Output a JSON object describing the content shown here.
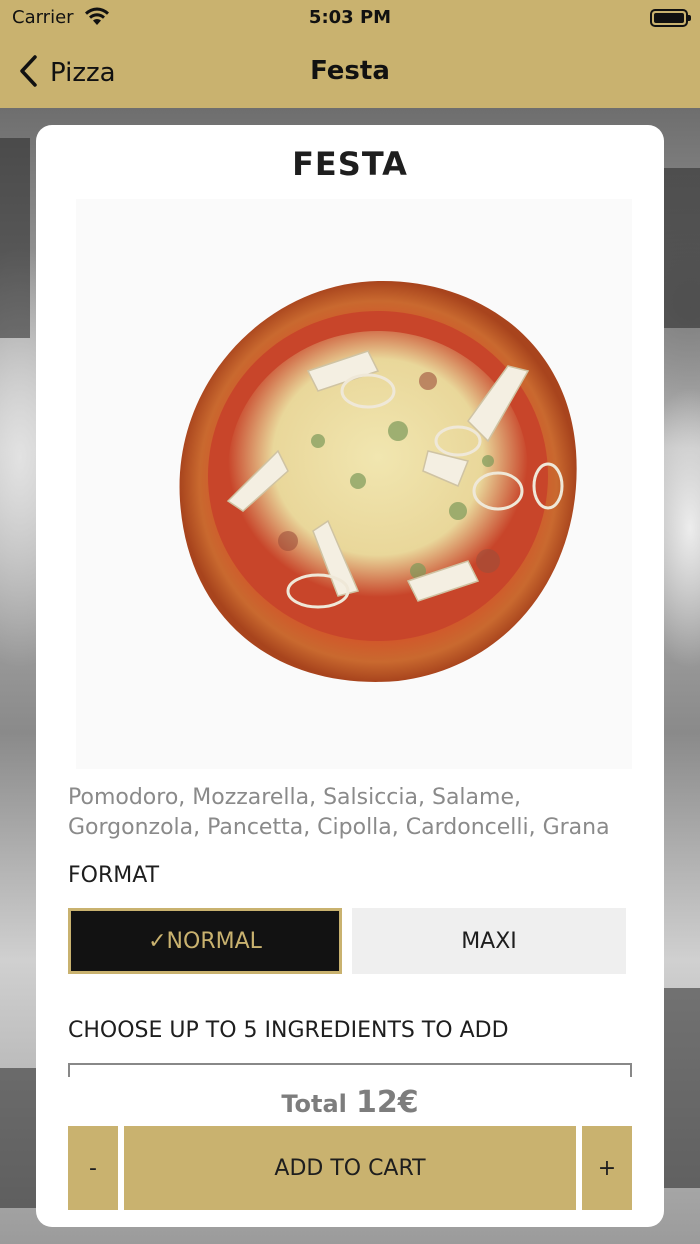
{
  "status_bar": {
    "carrier": "Carrier",
    "time": "5:03 PM"
  },
  "nav": {
    "back_label": "Pizza",
    "title": "Festa"
  },
  "product": {
    "name": "FESTA",
    "ingredients": "Pomodoro, Mozzarella, Salsiccia, Salame, Gorgonzola, Pancetta, Cipolla, Cardoncelli, Grana",
    "format_label": "FORMAT",
    "format_options": [
      {
        "label": "✓NORMAL",
        "selected": true
      },
      {
        "label": "MAXI",
        "selected": false
      }
    ],
    "choose_label": "CHOOSE UP TO 5 INGREDIENTS TO ADD"
  },
  "total": {
    "label": "Total",
    "value": "12€"
  },
  "actions": {
    "minus": "-",
    "add_to_cart": "ADD TO CART",
    "plus": "+"
  },
  "colors": {
    "accent": "#c9b26f",
    "selected_bg": "#121212",
    "unselected_bg": "#efefef"
  }
}
